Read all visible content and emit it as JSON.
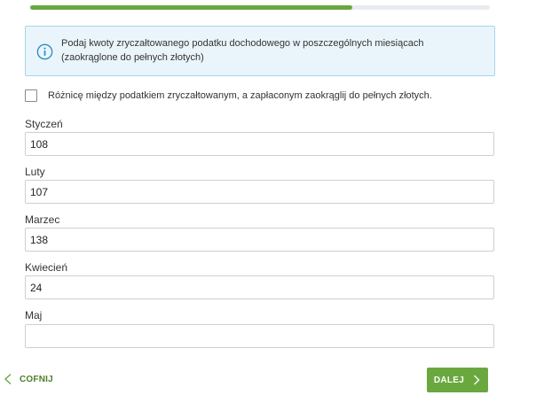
{
  "progress": {
    "fraction": 0.7
  },
  "info": {
    "icon": "info-icon",
    "text_line1": "Podaj kwoty zryczałtowanego podatku dochodowego w poszczególnych miesiącach",
    "text_line2": "(zaokrąglone do pełnych złotych)"
  },
  "rounding_checkbox": {
    "checked": false,
    "label": "Różnicę między podatkiem zryczałtowanym, a zapłaconym zaokrąglij do pełnych złotych."
  },
  "months": [
    {
      "label": "Styczeń",
      "value": "108"
    },
    {
      "label": "Luty",
      "value": "107"
    },
    {
      "label": "Marzec",
      "value": "138"
    },
    {
      "label": "Kwiecień",
      "value": "24"
    },
    {
      "label": "Maj",
      "value": ""
    }
  ],
  "navigation": {
    "back_label": "COFNIJ",
    "back_icon": "chevron-left-icon",
    "next_label": "DALEJ",
    "next_icon": "chevron-right-icon"
  },
  "colors": {
    "accent_green": "#6aa83f",
    "info_background": "#eaf5fb",
    "info_border": "#a9d4ea",
    "info_icon": "#2a8bc5"
  }
}
